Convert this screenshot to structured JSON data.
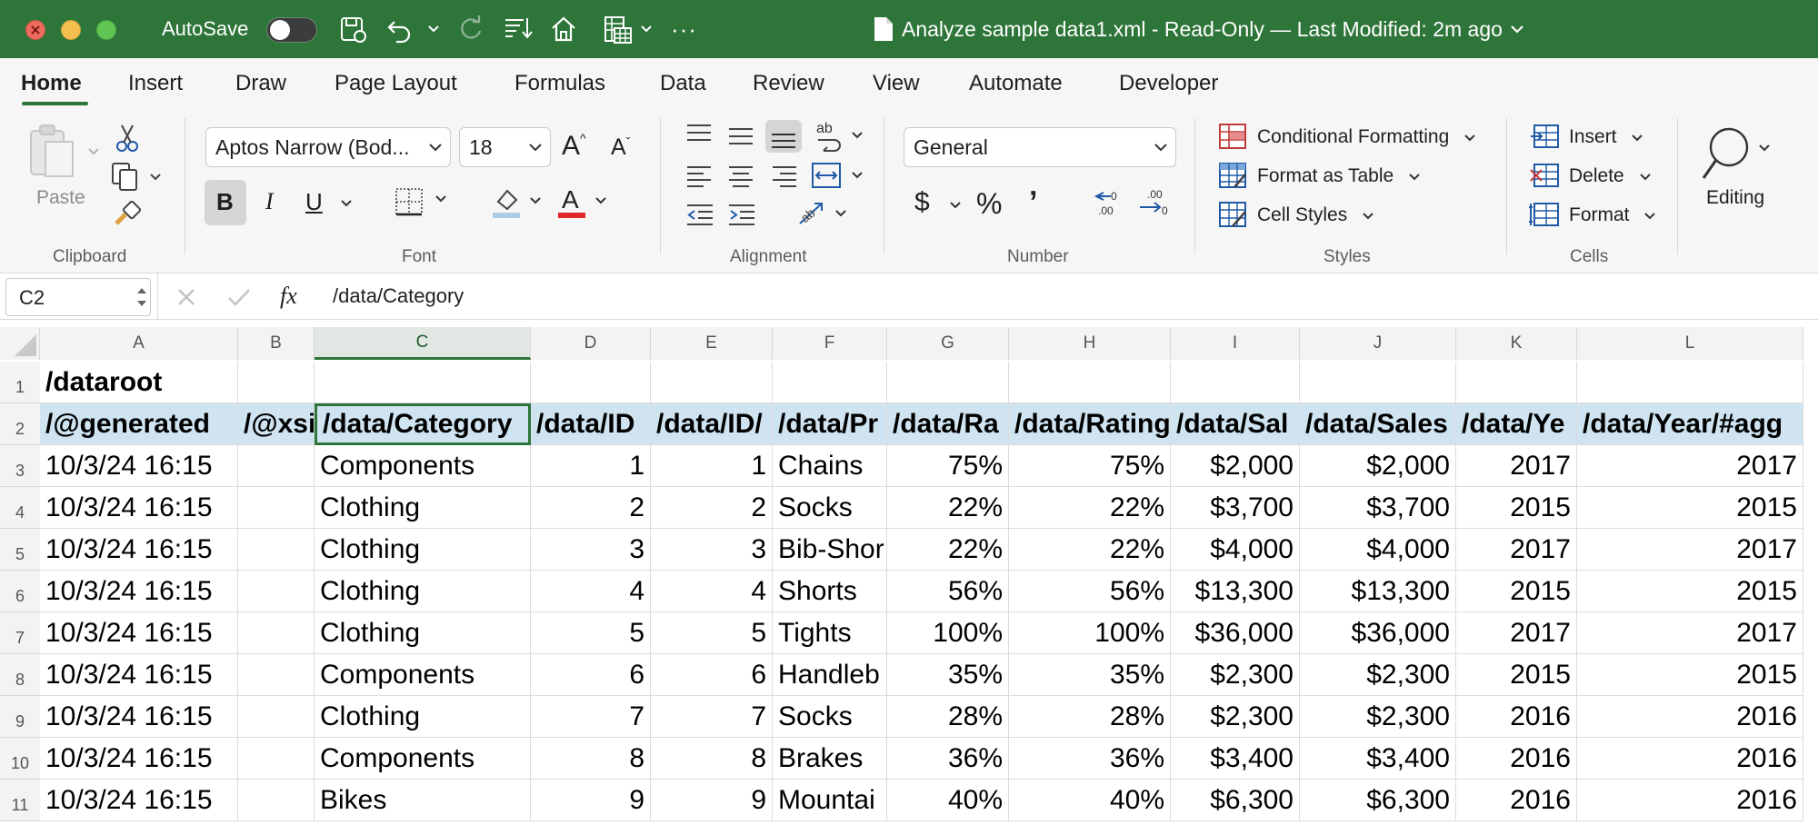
{
  "titlebar": {
    "autosave_label": "AutoSave",
    "autosave_state": "off",
    "document_title": "Analyze sample data1.xml  -  Read-Only — Last Modified: 2m ago",
    "more_label": "···",
    "colors": {
      "bar": "#2e7539",
      "close": "#ed6a5e",
      "minimize": "#f5bf4f",
      "zoom": "#61c554"
    }
  },
  "tabs": [
    "Home",
    "Insert",
    "Draw",
    "Page Layout",
    "Formulas",
    "Data",
    "Review",
    "View",
    "Automate",
    "Developer"
  ],
  "active_tab": "Home",
  "ribbon": {
    "clipboard": {
      "label": "Clipboard",
      "paste_label": "Paste"
    },
    "font": {
      "label": "Font",
      "font_name": "Aptos Narrow (Bod...",
      "font_size": "18",
      "bold": "B",
      "italic": "I",
      "underline": "U",
      "grow": "A",
      "shrink": "A",
      "color_letter": "A"
    },
    "alignment": {
      "label": "Alignment",
      "wrap_glyph": "ab"
    },
    "number": {
      "label": "Number",
      "format": "General",
      "currency": "$",
      "percent": "%",
      "comma": "ʼ"
    },
    "styles": {
      "label": "Styles",
      "conditional": "Conditional Formatting",
      "format_table": "Format as Table",
      "cell_styles": "Cell Styles"
    },
    "cells": {
      "label": "Cells",
      "insert": "Insert",
      "delete": "Delete",
      "format": "Format"
    },
    "editing": {
      "label": "Editing"
    }
  },
  "formula_bar": {
    "name_box": "C2",
    "fx": "fx",
    "content": "/data/Category"
  },
  "sheet": {
    "columns": [
      "A",
      "B",
      "C",
      "D",
      "E",
      "F",
      "G",
      "H",
      "I",
      "J",
      "K",
      "L"
    ],
    "selected_column": "C",
    "row_numbers": [
      "1",
      "2",
      "3",
      "4",
      "5",
      "6",
      "7",
      "8",
      "9",
      "10",
      "11"
    ],
    "rows": [
      [
        "/dataroot",
        "",
        "",
        "",
        "",
        "",
        "",
        "",
        "",
        "",
        "",
        ""
      ],
      [
        "/@generated",
        "/@xsi",
        "/data/Category",
        "/data/ID",
        "/data/ID/",
        "/data/Pr",
        "/data/Ra",
        "/data/Rating",
        "/data/Sal",
        "/data/Sales",
        "/data/Ye",
        "/data/Year/#agg"
      ],
      [
        "10/3/24 16:15",
        "",
        "Components",
        "1",
        "1",
        "Chains",
        "75%",
        "75%",
        "$2,000",
        "$2,000",
        "2017",
        "2017"
      ],
      [
        "10/3/24 16:15",
        "",
        "Clothing",
        "2",
        "2",
        "Socks",
        "22%",
        "22%",
        "$3,700",
        "$3,700",
        "2015",
        "2015"
      ],
      [
        "10/3/24 16:15",
        "",
        "Clothing",
        "3",
        "3",
        "Bib-Shor",
        "22%",
        "22%",
        "$4,000",
        "$4,000",
        "2017",
        "2017"
      ],
      [
        "10/3/24 16:15",
        "",
        "Clothing",
        "4",
        "4",
        "Shorts",
        "56%",
        "56%",
        "$13,300",
        "$13,300",
        "2015",
        "2015"
      ],
      [
        "10/3/24 16:15",
        "",
        "Clothing",
        "5",
        "5",
        "Tights",
        "100%",
        "100%",
        "$36,000",
        "$36,000",
        "2017",
        "2017"
      ],
      [
        "10/3/24 16:15",
        "",
        "Components",
        "6",
        "6",
        "Handleb",
        "35%",
        "35%",
        "$2,300",
        "$2,300",
        "2015",
        "2015"
      ],
      [
        "10/3/24 16:15",
        "",
        "Clothing",
        "7",
        "7",
        "Socks",
        "28%",
        "28%",
        "$2,300",
        "$2,300",
        "2016",
        "2016"
      ],
      [
        "10/3/24 16:15",
        "",
        "Components",
        "8",
        "8",
        "Brakes",
        "36%",
        "36%",
        "$3,400",
        "$3,400",
        "2016",
        "2016"
      ],
      [
        "10/3/24 16:15",
        "",
        "Bikes",
        "9",
        "9",
        "Mountai",
        "40%",
        "40%",
        "$6,300",
        "$6,300",
        "2016",
        "2016"
      ]
    ],
    "active_cell": "C2",
    "header_row_color": "#cfe3f1"
  }
}
